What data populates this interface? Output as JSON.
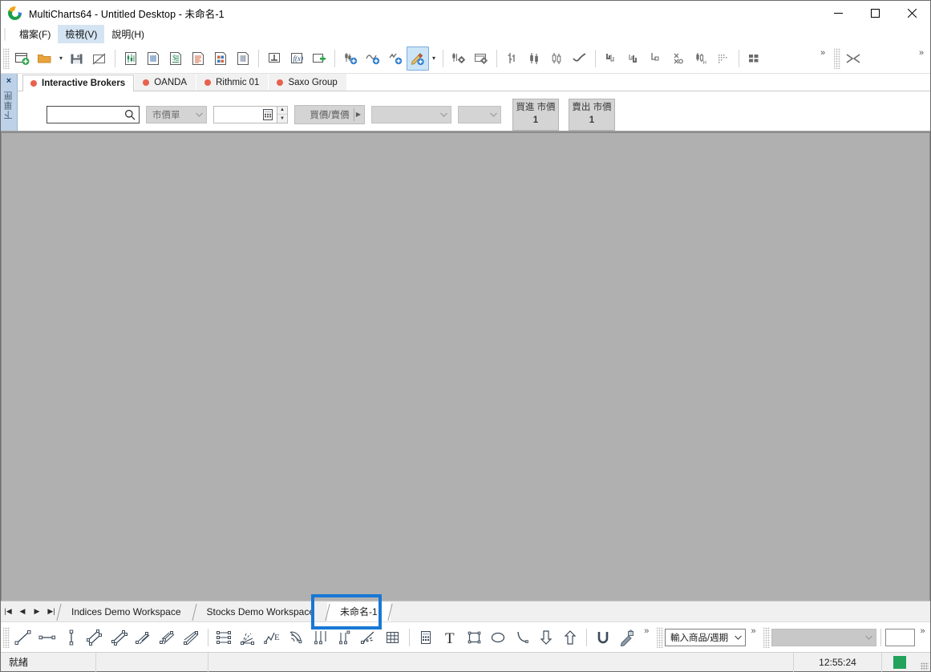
{
  "window": {
    "title": "MultiCharts64 - Untitled Desktop - 未命名-1",
    "minimize_label": "最小化",
    "maximize_label": "最大化",
    "close_label": "關閉"
  },
  "menu": {
    "items": [
      {
        "label": "檔案(F)",
        "active": false
      },
      {
        "label": "檢視(V)",
        "active": true
      },
      {
        "label": "說明(H)",
        "active": false
      }
    ]
  },
  "toolbar": {
    "overflow_label": "»",
    "dropdown_caret": "▾",
    "groups": [
      {
        "buttons": [
          {
            "name": "new-workspace-icon",
            "label": "新增工作底稿"
          },
          {
            "name": "open-workspace-icon",
            "label": "開啟工作底稿"
          },
          {
            "name": "save-workspace-icon",
            "label": "儲存工作底稿"
          },
          {
            "name": "close-workspace-icon",
            "label": "關閉工作底稿"
          }
        ]
      },
      {
        "buttons": [
          {
            "name": "new-chart-icon",
            "label": "新增圖表視窗"
          },
          {
            "name": "new-quote-page-icon",
            "label": "新增報價頁"
          },
          {
            "name": "new-market-depth-icon",
            "label": "新增市場深度"
          },
          {
            "name": "new-scanner-icon",
            "label": "新增掃描器"
          },
          {
            "name": "new-portfolio-icon",
            "label": "新增投資組合"
          },
          {
            "name": "new-order-book-icon",
            "label": "新增委託簿"
          }
        ]
      },
      {
        "buttons": [
          {
            "name": "insert-symbol-icon",
            "label": "插入商品"
          },
          {
            "name": "insert-function-icon",
            "label": "插入函數"
          },
          {
            "name": "insert-plugin-icon",
            "label": "插入外掛"
          }
        ]
      },
      {
        "buttons": [
          {
            "name": "insert-indicator-icon",
            "label": "插入指標"
          },
          {
            "name": "insert-signal-icon",
            "label": "插入訊號"
          },
          {
            "name": "insert-strategy-icon",
            "label": "插入策略"
          },
          {
            "name": "insert-drawing-icon",
            "label": "插入繪圖",
            "selected": true
          }
        ]
      },
      {
        "buttons": [
          {
            "name": "format-instrument-icon",
            "label": "設定商品"
          },
          {
            "name": "format-window-icon",
            "label": "設定視窗"
          }
        ]
      },
      {
        "buttons": [
          {
            "name": "bar-chart-icon",
            "label": "竹棒圖"
          },
          {
            "name": "candlestick-icon",
            "label": "K線圖"
          },
          {
            "name": "hollow-candle-icon",
            "label": "空心K線圖"
          },
          {
            "name": "line-chart-icon",
            "label": "折線圖"
          }
        ]
      },
      {
        "buttons": [
          {
            "name": "kagi-chart-icon",
            "label": "卡吉圖"
          },
          {
            "name": "renko-chart-icon",
            "label": "磚形圖"
          },
          {
            "name": "line-break-icon",
            "label": "新三價線"
          },
          {
            "name": "point-figure-icon",
            "label": "點數圖"
          },
          {
            "name": "heikin-ashi-icon",
            "label": "平均K線"
          },
          {
            "name": "dot-chart-icon",
            "label": "點圖"
          }
        ]
      },
      {
        "buttons": [
          {
            "name": "tile-windows-icon",
            "label": "排列視窗"
          }
        ]
      },
      {
        "buttons": [
          {
            "name": "compress-icon",
            "label": "壓縮"
          }
        ]
      }
    ]
  },
  "order_panel": {
    "close_label": "×",
    "panel_title": "下單匣",
    "broker_tabs": [
      {
        "label": "Interactive Brokers",
        "active": true,
        "status_color": "#e8614d"
      },
      {
        "label": "OANDA",
        "active": false,
        "status_color": "#e8614d"
      },
      {
        "label": "Rithmic 01",
        "active": false,
        "status_color": "#e8614d"
      },
      {
        "label": "Saxo Group",
        "active": false,
        "status_color": "#e8614d"
      }
    ],
    "symbol_input": {
      "value": "",
      "placeholder": ""
    },
    "order_type": {
      "value": "市價單"
    },
    "quantity": {
      "value": ""
    },
    "bid_ask_label": "買價/賣價",
    "extra_combo_1": {
      "value": ""
    },
    "extra_combo_2": {
      "value": ""
    },
    "buy_button": {
      "line1": "買進 市價",
      "line2": "1"
    },
    "sell_button": {
      "line1": "賣出 市價",
      "line2": "1"
    }
  },
  "workspace_tabs": {
    "nav": [
      {
        "name": "first-tab-button",
        "glyph": "|◀"
      },
      {
        "name": "prev-tab-button",
        "glyph": "◀"
      },
      {
        "name": "next-tab-button",
        "glyph": "▶"
      },
      {
        "name": "last-tab-button",
        "glyph": "▶|"
      }
    ],
    "tabs": [
      {
        "label": "Indices Demo Workspace",
        "active": false
      },
      {
        "label": "Stocks Demo Workspace",
        "active": false
      },
      {
        "label": "未命名-1",
        "active": true,
        "highlighted": true
      }
    ],
    "highlight_color": "#1878d4"
  },
  "drawing_toolbar": {
    "overflow_label": "»",
    "tools": [
      {
        "name": "trend-line-icon",
        "label": "趨勢線"
      },
      {
        "name": "horizontal-line-icon",
        "label": "水平線"
      },
      {
        "name": "vertical-line-icon",
        "label": "垂直線"
      },
      {
        "name": "parallel-channel-icon",
        "label": "平行通道"
      },
      {
        "name": "regression-channel-icon",
        "label": "回歸通道"
      },
      {
        "name": "fib-channel-icon",
        "label": "費波納契通道"
      },
      {
        "name": "raff-channel-icon",
        "label": "Raff 通道"
      },
      {
        "name": "andrews-pitchfork-icon",
        "label": "安德魯分叉線"
      },
      {
        "name": "fib-retracement-icon",
        "label": "費波納契回檔"
      },
      {
        "name": "fib-fan-icon",
        "label": "費波納契扇形"
      },
      {
        "name": "elliott-wave-icon",
        "label": "艾略特波浪"
      },
      {
        "name": "fib-arc-icon",
        "label": "費波納契弧形"
      },
      {
        "name": "cycle-lines-icon",
        "label": "週期線"
      },
      {
        "name": "time-cycle-icon",
        "label": "時間週期"
      },
      {
        "name": "gann-fan-icon",
        "label": "江恩扇形"
      },
      {
        "name": "gann-grid-icon",
        "label": "江恩網格"
      },
      {
        "name": "calculator-icon",
        "label": "計算機"
      },
      {
        "name": "text-tool-icon",
        "label": "文字"
      },
      {
        "name": "rectangle-tool-icon",
        "label": "矩形"
      },
      {
        "name": "ellipse-tool-icon",
        "label": "橢圓"
      },
      {
        "name": "arc-tool-icon",
        "label": "弧線"
      },
      {
        "name": "arrow-down-icon",
        "label": "向下箭頭"
      },
      {
        "name": "arrow-up-icon",
        "label": "向上箭頭"
      },
      {
        "name": "magnet-icon",
        "label": "磁吸"
      },
      {
        "name": "lock-drawing-icon",
        "label": "鎖定繪圖"
      }
    ],
    "symbol_period_combo": {
      "value": "輸入商品/週期"
    },
    "gray_combo": {
      "value": ""
    },
    "white_box": {
      "value": ""
    }
  },
  "status_bar": {
    "ready_text": "就緒",
    "time": "12:55:24",
    "connection_color": "#22a25a"
  }
}
